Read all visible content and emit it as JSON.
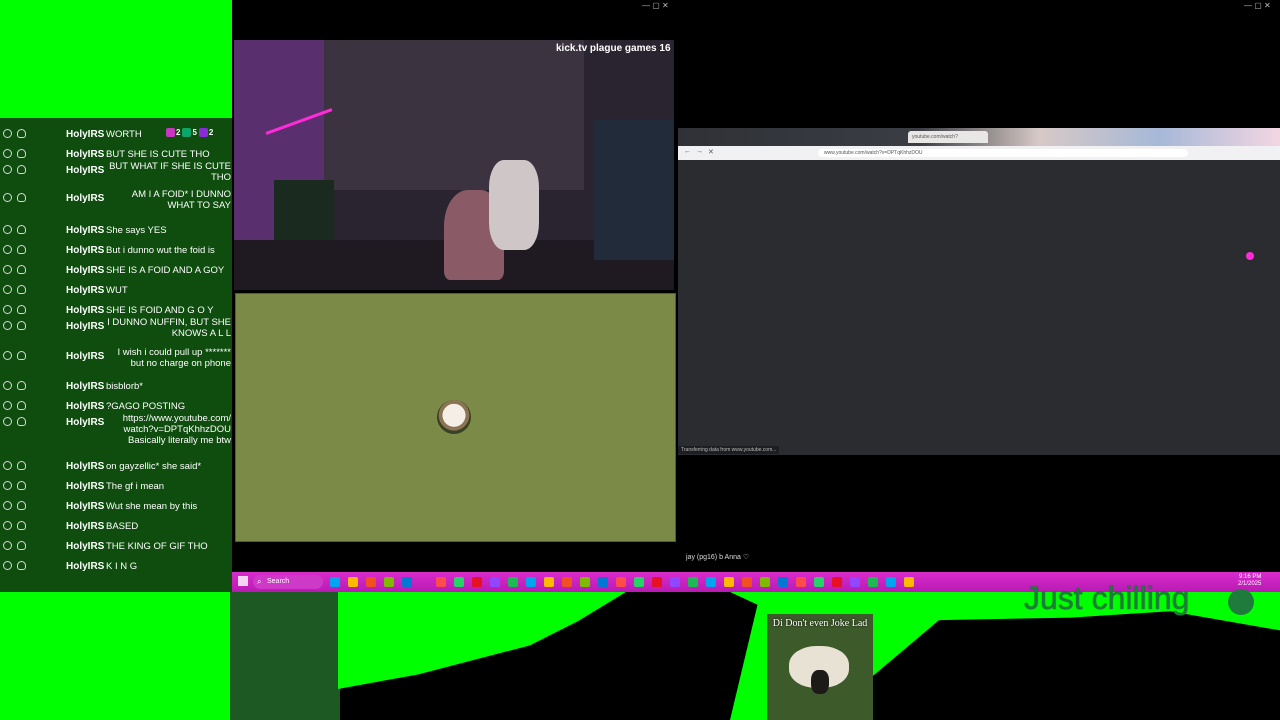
{
  "chat": {
    "badges": [
      "2",
      "5",
      "2"
    ],
    "messages": [
      {
        "user": "HolyIRS",
        "text": "WORTH"
      },
      {
        "user": "HolyIRS",
        "text": "BUT SHE IS CUTE THO"
      },
      {
        "user": "HolyIRS",
        "text": "BUT WHAT IF SHE IS CUTE\nTHO"
      },
      {
        "user": "HolyIRS",
        "text": "AM I A FOID* I DUNNO\nWHAT TO SAY"
      },
      {
        "user": "HolyIRS",
        "text": "She says YES"
      },
      {
        "user": "HolyIRS",
        "text": "But i dunno wut the foid is"
      },
      {
        "user": "HolyIRS",
        "text": "SHE IS A FOID AND A GOY"
      },
      {
        "user": "HolyIRS",
        "text": "WUT"
      },
      {
        "user": "HolyIRS",
        "text": "SHE IS FOID AND G O Y"
      },
      {
        "user": "HolyIRS",
        "text": "I DUNNO NUFFIN, BUT SHE\nKNOWS A L L"
      },
      {
        "user": "HolyIRS",
        "text": "I wish i could pull up *******\nbut no charge on phone"
      },
      {
        "user": "HolyIRS",
        "text": "bisblorb*"
      },
      {
        "user": "HolyIRS",
        "text": "?GAGO POSTING"
      },
      {
        "user": "HolyIRS",
        "text": "https://www.youtube.com/\nwatch?v=DPTqKhhzDOU\nBasically literally me btw"
      },
      {
        "user": "HolyIRS",
        "text": "on gayzellic* she said*"
      },
      {
        "user": "HolyIRS",
        "text": "The gf i mean"
      },
      {
        "user": "HolyIRS",
        "text": "Wut she mean by this"
      },
      {
        "user": "HolyIRS",
        "text": "BASED"
      },
      {
        "user": "HolyIRS",
        "text": "THE KING OF GIF THO"
      },
      {
        "user": "HolyIRS",
        "text": "K I N G"
      }
    ]
  },
  "stream": {
    "overlay_text": "kick.tv plague games 16"
  },
  "browser": {
    "tab_title": "youtube.com/watch?v=DPTqKhhzDOU",
    "url": "www.youtube.com/watch?v=DPTqKhhzDOU",
    "status": "Transferring data from www.youtube.com..."
  },
  "caption": "jay (pg16) b Anna ♡",
  "taskbar": {
    "search_label": "Search",
    "clock": "9:16 PM\n2/1/2025",
    "icon_colors": [
      "#00a4ef",
      "#ffb900",
      "#f25022",
      "#7fba00",
      "#0078d4",
      "#ff4b4b",
      "#25d366",
      "#e81123",
      "#9146ff",
      "#1db954"
    ]
  },
  "bottom": {
    "overlay_text": "Just chilling",
    "meme_caption": "Di Don't even Joke Lad"
  },
  "colors": {
    "green_screen": "#00ff00",
    "taskbar": "#d82ccc",
    "chat_bg": "#0f4d0f"
  }
}
